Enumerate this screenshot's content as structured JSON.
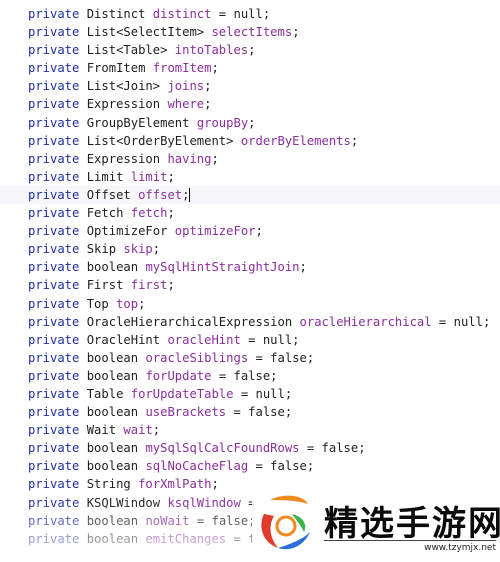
{
  "editor": {
    "lines": [
      {
        "kw": "private",
        "type": "Distinct",
        "field": "distinct",
        "rest": " = null;"
      },
      {
        "kw": "private",
        "type": "List<SelectItem>",
        "field": "selectItems",
        "rest": ";"
      },
      {
        "kw": "private",
        "type": "List<Table>",
        "field": "intoTables",
        "rest": ";"
      },
      {
        "kw": "private",
        "type": "FromItem",
        "field": "fromItem",
        "rest": ";"
      },
      {
        "kw": "private",
        "type": "List<Join>",
        "field": "joins",
        "rest": ";"
      },
      {
        "kw": "private",
        "type": "Expression",
        "field": "where",
        "rest": ";"
      },
      {
        "kw": "private",
        "type": "GroupByElement",
        "field": "groupBy",
        "rest": ";"
      },
      {
        "kw": "private",
        "type": "List<OrderByElement>",
        "field": "orderByElements",
        "rest": ";"
      },
      {
        "kw": "private",
        "type": "Expression",
        "field": "having",
        "rest": ";"
      },
      {
        "kw": "private",
        "type": "Limit",
        "field": "limit",
        "rest": ";"
      },
      {
        "kw": "private",
        "type": "Offset",
        "field": "offset",
        "rest": ";"
      },
      {
        "kw": "private",
        "type": "Fetch",
        "field": "fetch",
        "rest": ";"
      },
      {
        "kw": "private",
        "type": "OptimizeFor",
        "field": "optimizeFor",
        "rest": ";"
      },
      {
        "kw": "private",
        "type": "Skip",
        "field": "skip",
        "rest": ";"
      },
      {
        "kw": "private",
        "type": "boolean",
        "field": "mySqlHintStraightJoin",
        "rest": ";"
      },
      {
        "kw": "private",
        "type": "First",
        "field": "first",
        "rest": ";"
      },
      {
        "kw": "private",
        "type": "Top",
        "field": "top",
        "rest": ";"
      },
      {
        "kw": "private",
        "type": "OracleHierarchicalExpression",
        "field": "oracleHierarchical",
        "rest": " = null;"
      },
      {
        "kw": "private",
        "type": "OracleHint",
        "field": "oracleHint",
        "rest": " = null;"
      },
      {
        "kw": "private",
        "type": "boolean",
        "field": "oracleSiblings",
        "rest": " = false;"
      },
      {
        "kw": "private",
        "type": "boolean",
        "field": "forUpdate",
        "rest": " = false;"
      },
      {
        "kw": "private",
        "type": "Table",
        "field": "forUpdateTable",
        "rest": " = null;"
      },
      {
        "kw": "private",
        "type": "boolean",
        "field": "useBrackets",
        "rest": " = false;"
      },
      {
        "kw": "private",
        "type": "Wait",
        "field": "wait",
        "rest": ";"
      },
      {
        "kw": "private",
        "type": "boolean",
        "field": "mySqlSqlCalcFoundRows",
        "rest": " = false;"
      },
      {
        "kw": "private",
        "type": "boolean",
        "field": "sqlNoCacheFlag",
        "rest": " = false;"
      },
      {
        "kw": "private",
        "type": "String",
        "field": "forXmlPath",
        "rest": ";"
      },
      {
        "kw": "private",
        "type": "KSQLWindow",
        "field": "ksqlWindow",
        "rest": " ="
      },
      {
        "kw": "private",
        "type": "boolean",
        "field": "noWait",
        "rest": " = false;"
      },
      {
        "kw": "private",
        "type": "boolean",
        "field": "emitChanges",
        "rest": " = f"
      }
    ],
    "current_line_index": 10
  },
  "watermark": {
    "title": "精选手游网",
    "url": "www.tzymjx.net",
    "colors": {
      "logo_orange": "#f08a1c",
      "logo_red": "#e23a2a",
      "logo_green": "#3bb54a",
      "logo_blue": "#2d6fd6"
    }
  },
  "colors": {
    "keyword": "#1f2f9f",
    "field": "#8a2f9b",
    "text": "#1f1f1f",
    "current_line_bg": "#f6f6fb"
  }
}
